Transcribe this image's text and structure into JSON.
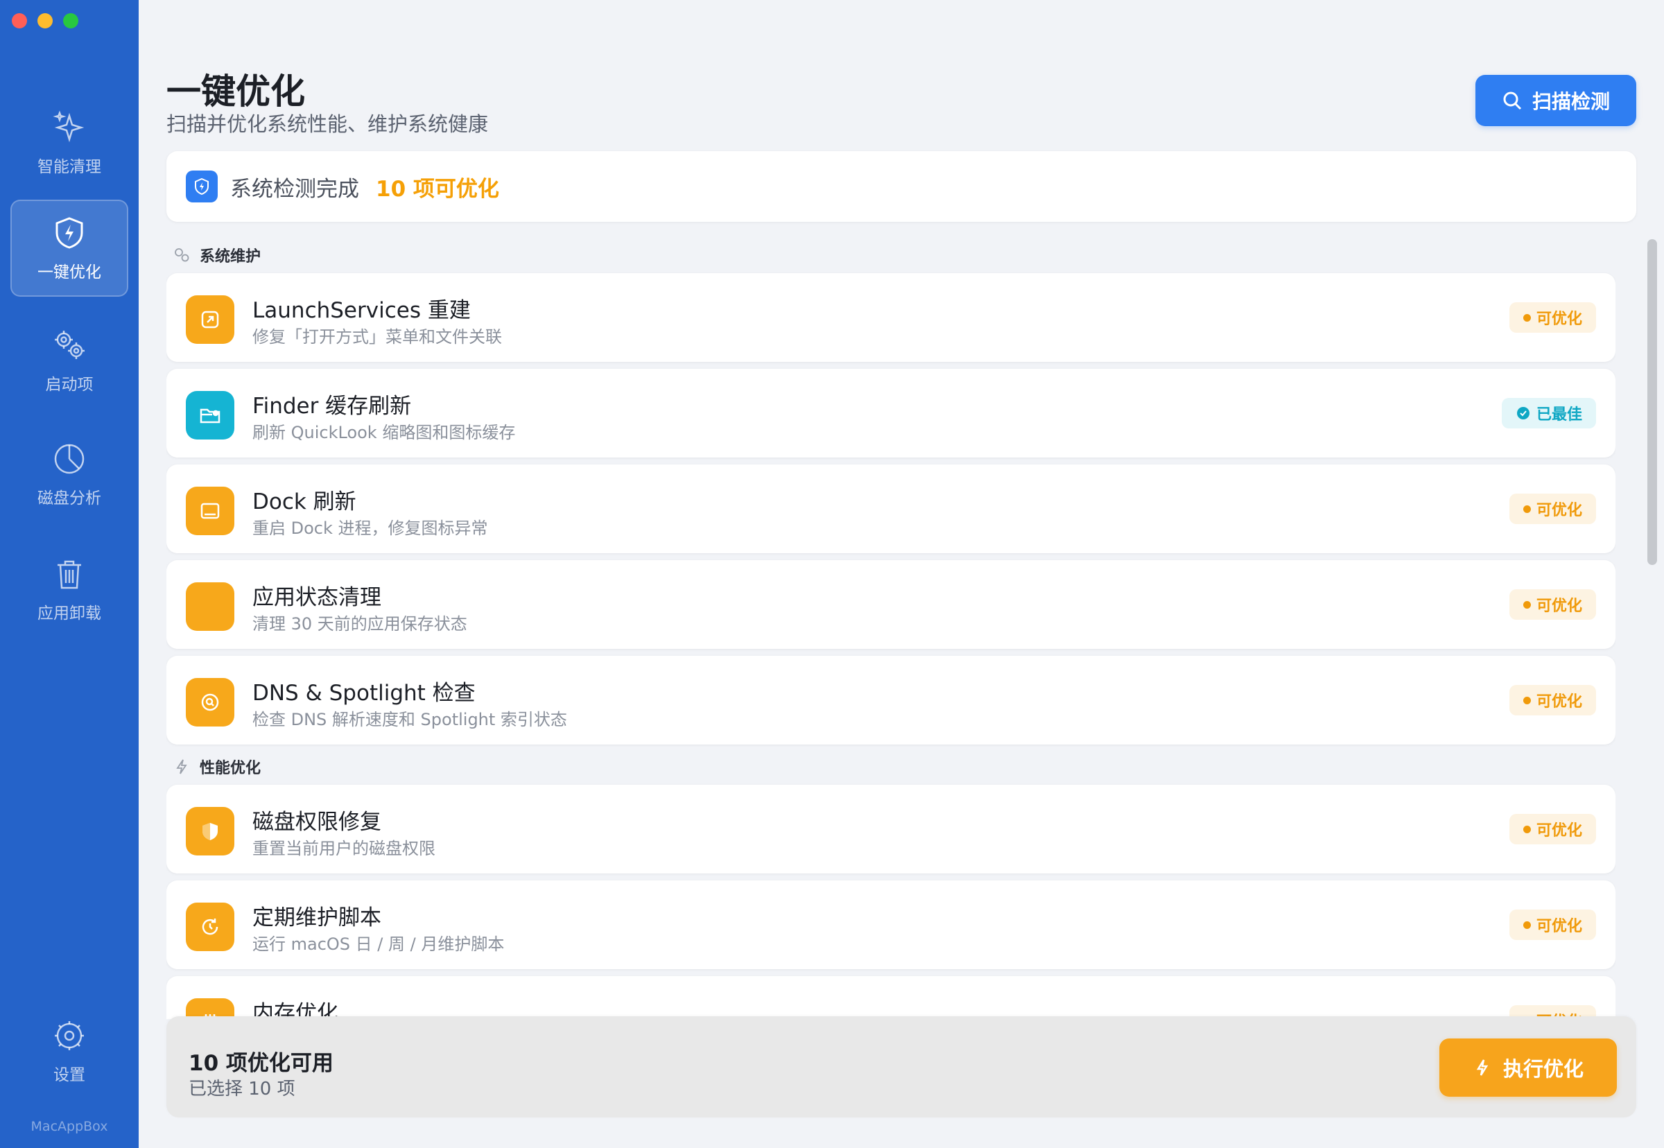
{
  "app": {
    "brand": "MacAppBox"
  },
  "sidebar": {
    "items": [
      {
        "label": "智能清理",
        "icon": "sparkle-icon",
        "active": false
      },
      {
        "label": "一键优化",
        "icon": "shield-bolt-icon",
        "active": true
      },
      {
        "label": "启动项",
        "icon": "gears-icon",
        "active": false
      },
      {
        "label": "磁盘分析",
        "icon": "pie-chart-icon",
        "active": false
      },
      {
        "label": "应用卸载",
        "icon": "trash-icon",
        "active": false
      }
    ],
    "settings_label": "设置"
  },
  "header": {
    "title": "一键优化",
    "subtitle": "扫描并优化系统性能、维护系统健康",
    "scan_button": "扫描检测"
  },
  "status": {
    "text": "系统检测完成",
    "count": "10 项可优化"
  },
  "sections": {
    "maintenance": "系统维护",
    "performance": "性能优化"
  },
  "items": [
    {
      "title": "LaunchServices 重建",
      "desc": "修复「打开方式」菜单和文件关联",
      "badge": "可优化",
      "state": "warn",
      "icon": "arrow-box-icon"
    },
    {
      "title": "Finder 缓存刷新",
      "desc": "刷新 QuickLook 缩略图和图标缓存",
      "badge": "已最佳",
      "state": "ok",
      "icon": "folder-gear-icon"
    },
    {
      "title": "Dock 刷新",
      "desc": "重启 Dock 进程，修复图标异常",
      "badge": "可优化",
      "state": "warn",
      "icon": "dock-icon"
    },
    {
      "title": "应用状态清理",
      "desc": "清理 30 天前的应用保存状态",
      "badge": "可优化",
      "state": "warn",
      "icon": "blank-icon"
    },
    {
      "title": "DNS & Spotlight 检查",
      "desc": "检查 DNS 解析速度和 Spotlight 索引状态",
      "badge": "可优化",
      "state": "warn",
      "icon": "search-circle-icon"
    },
    {
      "title": "磁盘权限修复",
      "desc": "重置当前用户的磁盘权限",
      "badge": "可优化",
      "state": "warn",
      "icon": "shield-half-icon"
    },
    {
      "title": "定期维护脚本",
      "desc": "运行 macOS 日 / 周 / 月维护脚本",
      "badge": "可优化",
      "state": "warn",
      "icon": "refresh-clock-icon"
    },
    {
      "title": "内存优化",
      "desc": "",
      "badge": "可优化",
      "state": "warn",
      "icon": "memory-icon"
    }
  ],
  "footer": {
    "title": "10 项优化可用",
    "selected": "已选择 10 项",
    "execute_button": "执行优化"
  },
  "colors": {
    "sidebar": "#2563c9",
    "accent_blue": "#2f7ef2",
    "accent_orange": "#f7a41c",
    "ok_teal": "#0fa7c4"
  }
}
